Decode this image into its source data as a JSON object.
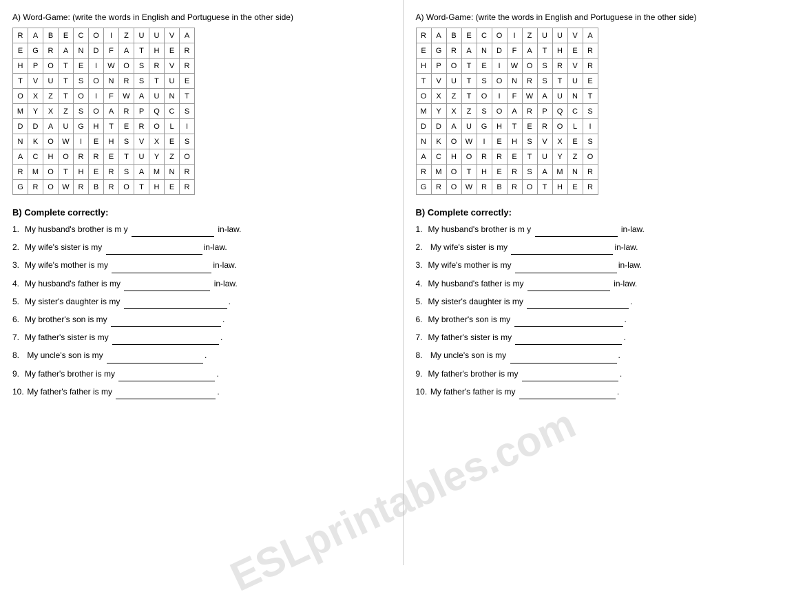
{
  "left": {
    "section_a_label": "A)   Word-Game: (write the words in English and Portuguese in the other side)",
    "grid": [
      [
        "R",
        "A",
        "B",
        "E",
        "C",
        "O",
        "I",
        "Z",
        "U",
        "U",
        "V",
        "A"
      ],
      [
        "E",
        "G",
        "R",
        "A",
        "N",
        "D",
        "F",
        "A",
        "T",
        "H",
        "E",
        "R"
      ],
      [
        "H",
        "P",
        "O",
        "T",
        "E",
        "I",
        "W",
        "O",
        "S",
        "R",
        "V",
        "R"
      ],
      [
        "T",
        "V",
        "U",
        "T",
        "S",
        "O",
        "N",
        "R",
        "S",
        "T",
        "U",
        "E"
      ],
      [
        "O",
        "X",
        "Z",
        "T",
        "O",
        "I",
        "F",
        "W",
        "A",
        "U",
        "N",
        "T"
      ],
      [
        "M",
        "Y",
        "X",
        "Z",
        "S",
        "O",
        "A",
        "R",
        "P",
        "Q",
        "C",
        "S"
      ],
      [
        "D",
        "D",
        "A",
        "U",
        "G",
        "H",
        "T",
        "E",
        "R",
        "O",
        "L",
        "I"
      ],
      [
        "N",
        "K",
        "O",
        "W",
        "I",
        "E",
        "H",
        "S",
        "V",
        "X",
        "E",
        "S"
      ],
      [
        "A",
        "C",
        "H",
        "O",
        "R",
        "R",
        "E",
        "T",
        "U",
        "Y",
        "Z",
        "O"
      ],
      [
        "R",
        "M",
        "O",
        "T",
        "H",
        "E",
        "R",
        "S",
        "A",
        "M",
        "N",
        "R"
      ],
      [
        "G",
        "R",
        "O",
        "W",
        "R",
        "B",
        "R",
        "O",
        "T",
        "H",
        "E",
        "R"
      ]
    ],
    "section_b_label": "B) Complete correctly:",
    "questions": [
      {
        "num": "1.",
        "text": "My husband's brother is m  y",
        "blank_size": 120,
        "suffix": " in-law."
      },
      {
        "num": "2.",
        "text": "My wife's sister is my",
        "blank_size": 140,
        "suffix": "in-law."
      },
      {
        "num": "3.",
        "text": "My wife's mother is my",
        "blank_size": 145,
        "suffix": "in-law."
      },
      {
        "num": "4.",
        "text": "My husband's father is my",
        "blank_size": 125,
        "suffix": " in-law."
      },
      {
        "num": "5.",
        "text": "My sister's daughter is my",
        "blank_size": 150,
        "suffix": "."
      },
      {
        "num": "6.",
        "text": "My brother's son is my",
        "blank_size": 160,
        "suffix": "."
      },
      {
        "num": "7.",
        "text": "My father's sister is my",
        "blank_size": 155,
        "suffix": "."
      },
      {
        "num": "8.",
        "text": "  My uncle's son is my",
        "blank_size": 140,
        "suffix": "."
      },
      {
        "num": "9.",
        "text": "My father's brother is my",
        "blank_size": 140,
        "suffix": "."
      },
      {
        "num": "10.",
        "text": "  My father's father is my",
        "blank_size": 145,
        "suffix": "."
      }
    ]
  },
  "right": {
    "section_a_label": "A)   Word-Game: (write the words in English and Portuguese in the other side)",
    "grid": [
      [
        "R",
        "A",
        "B",
        "E",
        "C",
        "O",
        "I",
        "Z",
        "U",
        "U",
        "V",
        "A"
      ],
      [
        "E",
        "G",
        "R",
        "A",
        "N",
        "D",
        "F",
        "A",
        "T",
        "H",
        "E",
        "R"
      ],
      [
        "H",
        "P",
        "O",
        "T",
        "E",
        "I",
        "W",
        "O",
        "S",
        "R",
        "V",
        "R"
      ],
      [
        "T",
        "V",
        "U",
        "T",
        "S",
        "O",
        "N",
        "R",
        "S",
        "T",
        "U",
        "E"
      ],
      [
        "O",
        "X",
        "Z",
        "T",
        "O",
        "I",
        "F",
        "W",
        "A",
        "U",
        "N",
        "T"
      ],
      [
        "M",
        "Y",
        "X",
        "Z",
        "S",
        "O",
        "A",
        "R",
        "P",
        "Q",
        "C",
        "S"
      ],
      [
        "D",
        "D",
        "A",
        "U",
        "G",
        "H",
        "T",
        "E",
        "R",
        "O",
        "L",
        "I"
      ],
      [
        "N",
        "K",
        "O",
        "W",
        "I",
        "E",
        "H",
        "S",
        "V",
        "X",
        "E",
        "S"
      ],
      [
        "A",
        "C",
        "H",
        "O",
        "R",
        "R",
        "E",
        "T",
        "U",
        "Y",
        "Z",
        "O"
      ],
      [
        "R",
        "M",
        "O",
        "T",
        "H",
        "E",
        "R",
        "S",
        "A",
        "M",
        "N",
        "R"
      ],
      [
        "G",
        "R",
        "O",
        "W",
        "R",
        "B",
        "R",
        "O",
        "T",
        "H",
        "E",
        "R"
      ]
    ],
    "section_b_label": "B) Complete correctly:",
    "questions": [
      {
        "num": "1.",
        "text": "My husband's brother is m  y",
        "blank_size": 120,
        "suffix": " in-law."
      },
      {
        "num": "2.",
        "text": "  My wife's sister is my",
        "blank_size": 148,
        "suffix": "in-law."
      },
      {
        "num": "3.",
        "text": "My wife's mother is my",
        "blank_size": 148,
        "suffix": "in-law."
      },
      {
        "num": "4.",
        "text": "My husband's father is my",
        "blank_size": 120,
        "suffix": " in-law."
      },
      {
        "num": "5.",
        "text": "My sister's daughter is my",
        "blank_size": 148,
        "suffix": "."
      },
      {
        "num": "6.",
        "text": "My brother's son is my",
        "blank_size": 158,
        "suffix": "."
      },
      {
        "num": "7.",
        "text": "My father's sister is my",
        "blank_size": 155,
        "suffix": "."
      },
      {
        "num": "8.",
        "text": "  My uncle's son is my",
        "blank_size": 155,
        "suffix": "."
      },
      {
        "num": "9.",
        "text": "My father's brother is my",
        "blank_size": 140,
        "suffix": "."
      },
      {
        "num": "10.",
        "text": "  My father's father is my",
        "blank_size": 140,
        "suffix": "."
      }
    ]
  },
  "watermark": "ESLprintables.com"
}
